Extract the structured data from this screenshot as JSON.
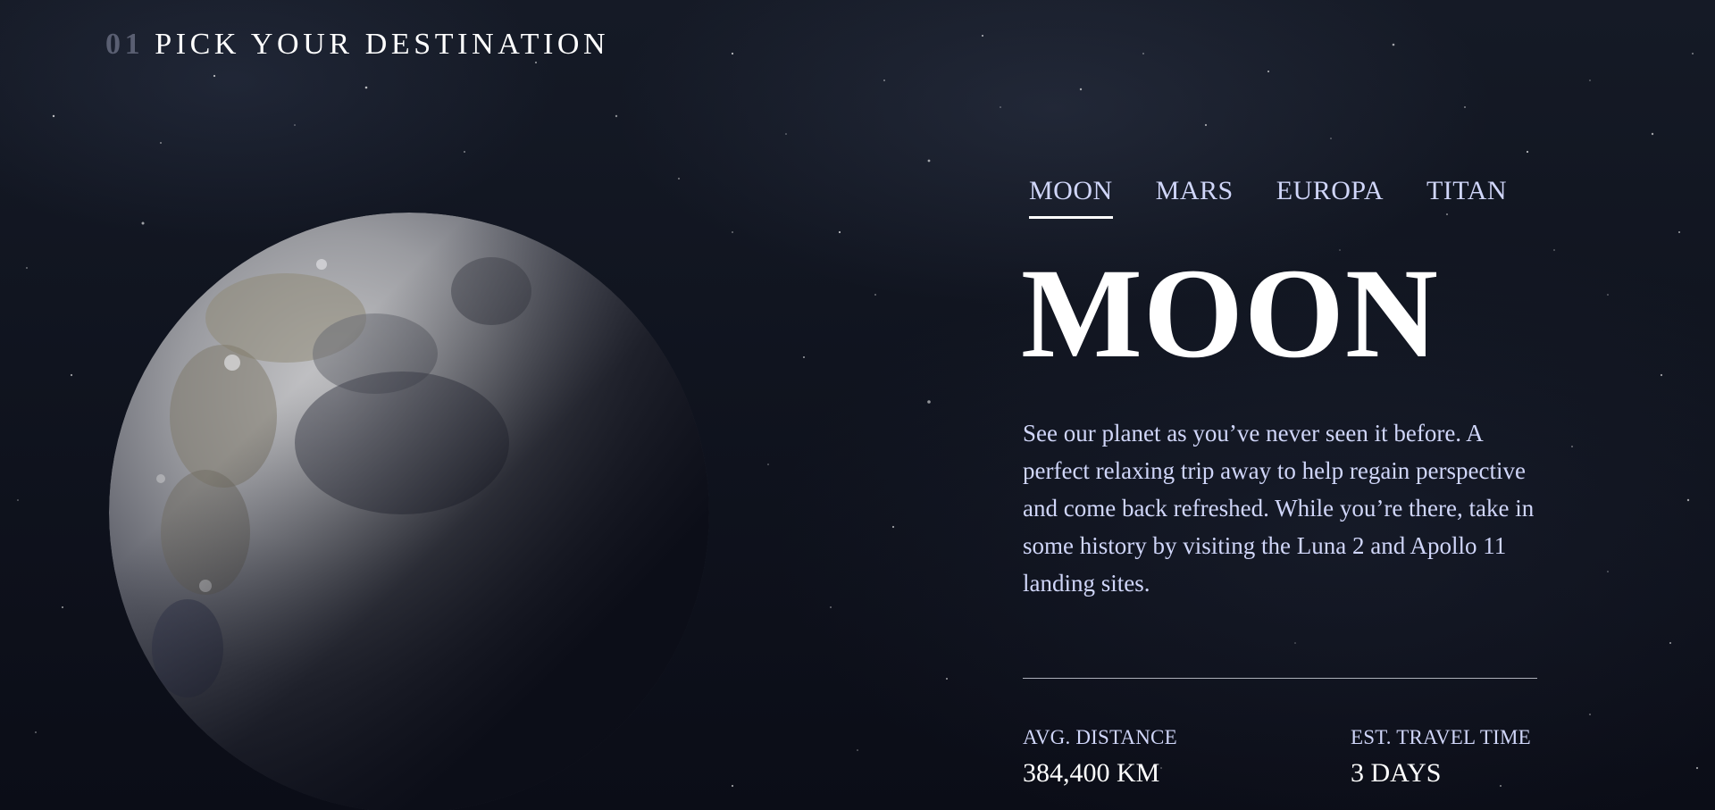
{
  "header": {
    "number": "01",
    "title": "PICK YOUR DESTINATION"
  },
  "tabs": [
    {
      "label": "MOON",
      "active": true
    },
    {
      "label": "MARS",
      "active": false
    },
    {
      "label": "EUROPA",
      "active": false
    },
    {
      "label": "TITAN",
      "active": false
    }
  ],
  "destination": {
    "name": "MOON",
    "description": "See our planet as you’ve never seen it before. A perfect relaxing trip away to help regain perspective and come back refreshed. While you’re there, take in some history by visiting the Luna 2 and Apollo 11 landing sites.",
    "distance_label": "AVG. DISTANCE",
    "distance_value": "384,400 KM",
    "travel_label": "EST. TRAVEL TIME",
    "travel_value": "3 DAYS"
  },
  "image": {
    "icon": "moon-image"
  },
  "colors": {
    "background": "#0b0d17",
    "accent_text": "#d0d6f9",
    "white": "#ffffff",
    "number_gray": "#5a5f72"
  }
}
